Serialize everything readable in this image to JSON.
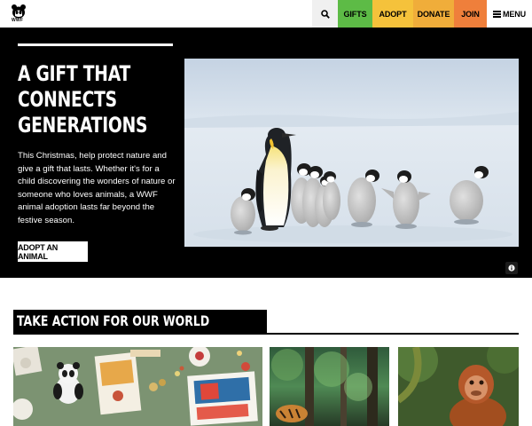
{
  "header": {
    "logo_text": "WWF",
    "nav": {
      "gifts": "GIFTS",
      "adopt": "ADOPT",
      "donate": "DONATE",
      "join": "JOIN",
      "menu": "MENU"
    }
  },
  "hero": {
    "title_lines": [
      "A GIFT THAT",
      "CONNECTS",
      "GENERATIONS"
    ],
    "body": "This Christmas, help protect nature and give a gift that lasts. Whether it's for a child discovering the wonders of nature or someone who loves animals, a WWF animal adoption lasts far beyond the festive season.",
    "button": "ADOPT AN ANIMAL"
  },
  "take_action": {
    "title": "TAKE ACTION FOR OUR WORLD"
  },
  "colors": {
    "gifts": "#5dbb46",
    "adopt": "#f5c23b",
    "donate": "#f0ad3a",
    "join": "#ef7f3b",
    "hero_bg": "#000000"
  },
  "icons": {
    "search": "search-icon",
    "menu": "hamburger-icon",
    "info": "info-icon",
    "logo": "panda-logo-icon"
  }
}
